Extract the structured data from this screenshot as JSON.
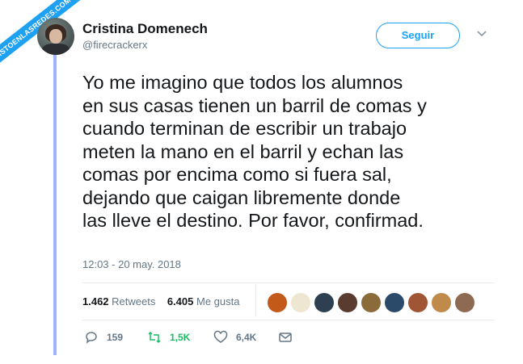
{
  "watermark": "VISTOENLASREDES.COM",
  "author": {
    "name": "Cristina Domenech",
    "handle": "@firecrackerx"
  },
  "follow_button": "Seguir",
  "tweet_lines": [
    "Yo me imagino que todos los alumnos",
    "en sus casas tienen un barril de comas y",
    "cuando terminan de escribir un trabajo",
    "meten la mano en el barril y echan las",
    "comas por encima como si fuera sal,",
    "dejando que caigan libremente donde",
    "las lleve el destino. Por favor, confirmad."
  ],
  "timestamp": "12:03 - 20 may. 2018",
  "stats": {
    "retweets_count": "1.462",
    "retweets_label": "Retweets",
    "likes_count": "6.405",
    "likes_label": "Me gusta"
  },
  "liker_colors": [
    "#c45a1a",
    "#efe6d2",
    "#2e3f52",
    "#5a3b2f",
    "#8c6b3a",
    "#2b4a6a",
    "#a05535",
    "#c08a4a",
    "#8f6a52"
  ],
  "actions": {
    "replies": "159",
    "retweets": "1,5K",
    "likes": "6,4K"
  },
  "colors": {
    "accent": "#1da1f2",
    "retweet_green": "#17bf63",
    "muted": "#657786"
  }
}
